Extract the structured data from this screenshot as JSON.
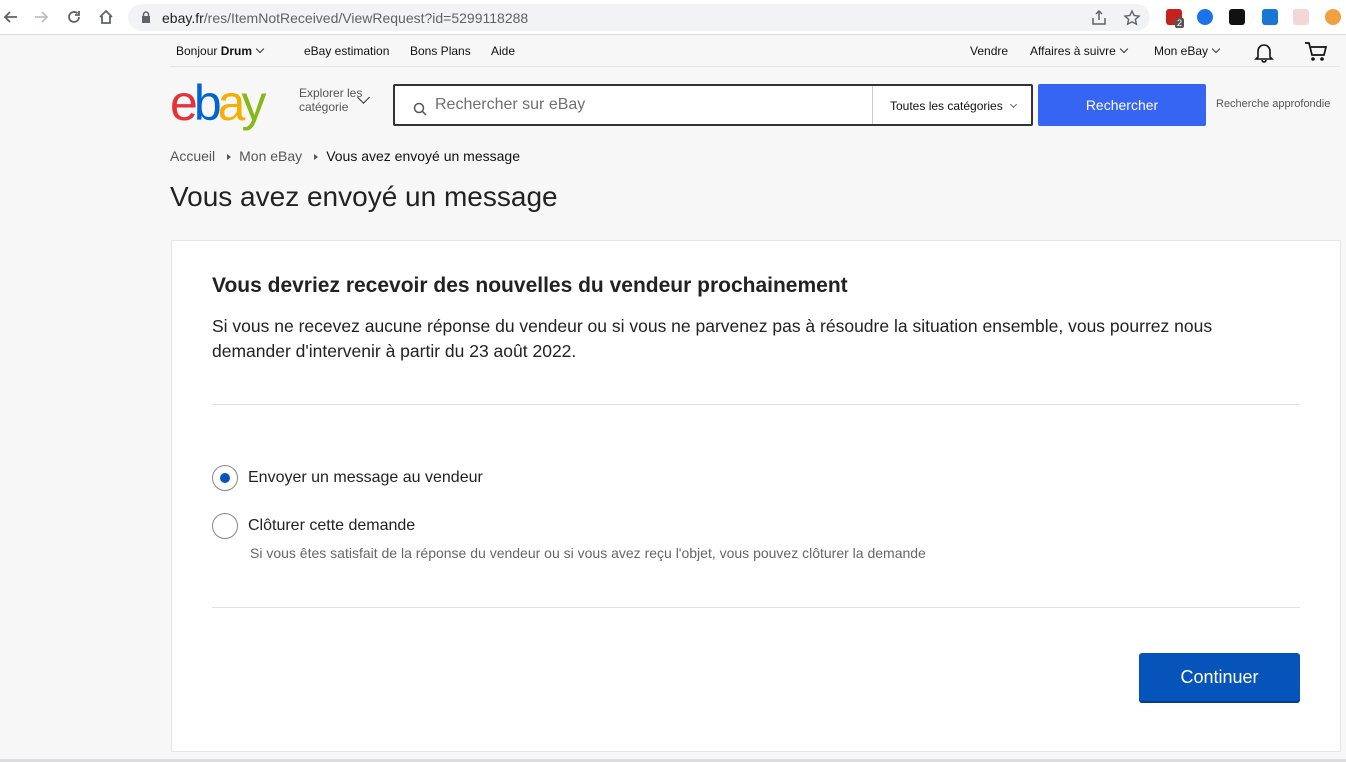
{
  "browser": {
    "url_host": "ebay.fr",
    "url_path": "/res/ItemNotReceived/ViewRequest?id=5299118288",
    "ext_badge": "2"
  },
  "topnav": {
    "greeting": "Bonjour",
    "user": "Drum",
    "links": [
      "eBay estimation",
      "Bons Plans",
      "Aide"
    ],
    "sell": "Vendre",
    "watchlist": "Affaires à suivre",
    "my_ebay": "Mon eBay"
  },
  "header": {
    "explore_label": "Explorer les catégorie",
    "search_placeholder": "Rechercher sur eBay",
    "category_selected": "Toutes les catégories",
    "search_button": "Rechercher",
    "advanced_link": "Recherche approfondie"
  },
  "breadcrumb": {
    "items": [
      "Accueil",
      "Mon eBay",
      "Vous avez envoyé un message"
    ]
  },
  "page": {
    "title": "Vous avez envoyé un message"
  },
  "card": {
    "heading": "Vous devriez recevoir des nouvelles du vendeur prochainement",
    "description": "Si vous ne recevez aucune réponse du vendeur ou si vous ne parvenez pas à résoudre la situation ensemble, vous pourrez nous demander d'intervenir à partir du 23 août 2022.",
    "options": [
      {
        "label": "Envoyer un message au vendeur",
        "selected": true
      },
      {
        "label": "Clôturer cette demande",
        "selected": false,
        "help": "Si vous êtes satisfait de la réponse du vendeur ou si vous avez reçu l'objet, vous pouvez clôturer la demande"
      }
    ],
    "continue_button": "Continuer"
  },
  "colors": {
    "ebay_red": "#e53238",
    "ebay_blue": "#0064d2",
    "ebay_yellow": "#f5af02",
    "ebay_green": "#86b817",
    "search_button": "#3665f3",
    "primary_button": "#0654ba"
  }
}
